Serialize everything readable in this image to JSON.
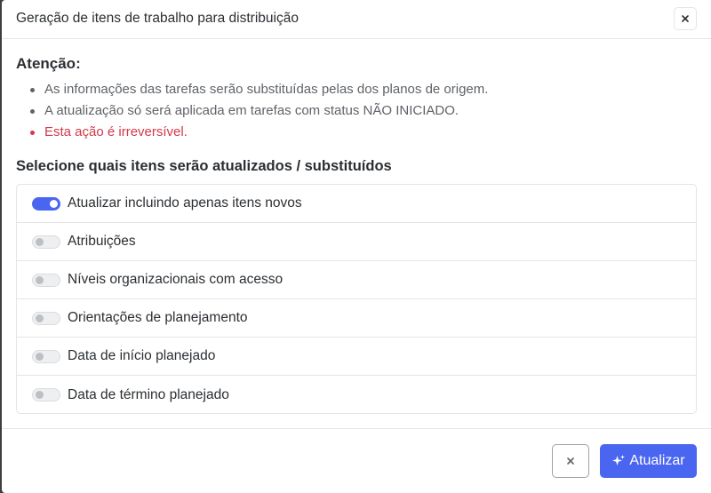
{
  "dialog": {
    "title": "Geração de itens de trabalho para distribuição",
    "close_icon": "close-icon"
  },
  "attention": {
    "title": "Atenção:",
    "notes": [
      {
        "text": "As informações das tarefas serão substituídas pelas dos planos de origem.",
        "style": "normal"
      },
      {
        "text": "A atualização só será aplicada em tarefas com status NÃO INICIADO.",
        "style": "normal"
      },
      {
        "text": "Esta ação é irreversível.",
        "style": "danger"
      }
    ]
  },
  "selection": {
    "title": "Selecione quais itens serão atualizados / substituídos",
    "options": [
      {
        "label": "Atualizar incluindo apenas itens novos",
        "enabled": true
      },
      {
        "label": "Atribuições",
        "enabled": false
      },
      {
        "label": "Níveis organizacionais com acesso",
        "enabled": false
      },
      {
        "label": "Orientações de planejamento",
        "enabled": false
      },
      {
        "label": "Data de início planejado",
        "enabled": false
      },
      {
        "label": "Data de término planejado",
        "enabled": false
      }
    ]
  },
  "footer": {
    "cancel_icon": "close-icon",
    "update_label": "Atualizar",
    "update_icon": "sparkles-icon"
  },
  "colors": {
    "accent": "#4a66f0",
    "danger": "#d0394a",
    "text": "#2b2f33",
    "muted_text": "#5f6368"
  }
}
